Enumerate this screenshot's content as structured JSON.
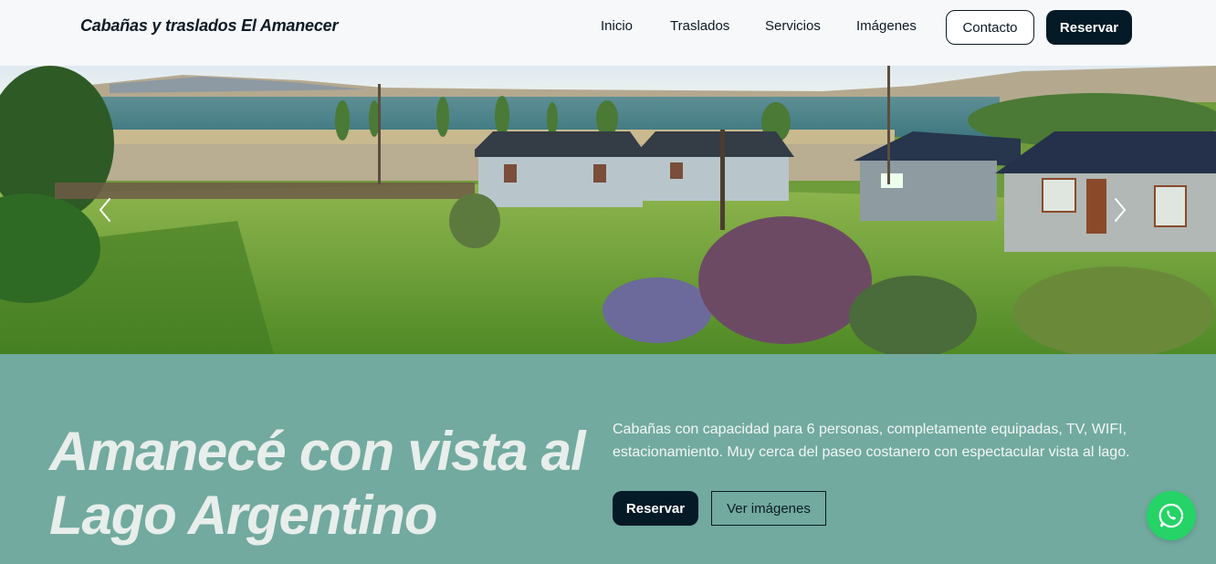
{
  "header": {
    "brand": "Cabañas y traslados El Amanecer",
    "nav": [
      {
        "label": "Inicio"
      },
      {
        "label": "Traslados"
      },
      {
        "label": "Servicios"
      },
      {
        "label": "Imágenes"
      }
    ],
    "contact_label": "Contacto",
    "reserve_label": "Reservar"
  },
  "hero": {
    "prev_icon": "chevron-left-icon",
    "next_icon": "chevron-right-icon"
  },
  "band": {
    "headline": "Amanecé con vista al Lago Argentino",
    "description": "Cabañas con capacidad para 6 personas, completamente equipadas, TV, WIFI, estacionamiento. Muy cerca del paseo costanero con espectacular vista al lago.",
    "reserve_label": "Reservar",
    "images_label": "Ver imágenes"
  },
  "whatsapp": {
    "icon": "whatsapp-icon"
  },
  "colors": {
    "dark": "#041a26",
    "teal": "#72aa9f",
    "whatsapp": "#25d366"
  }
}
